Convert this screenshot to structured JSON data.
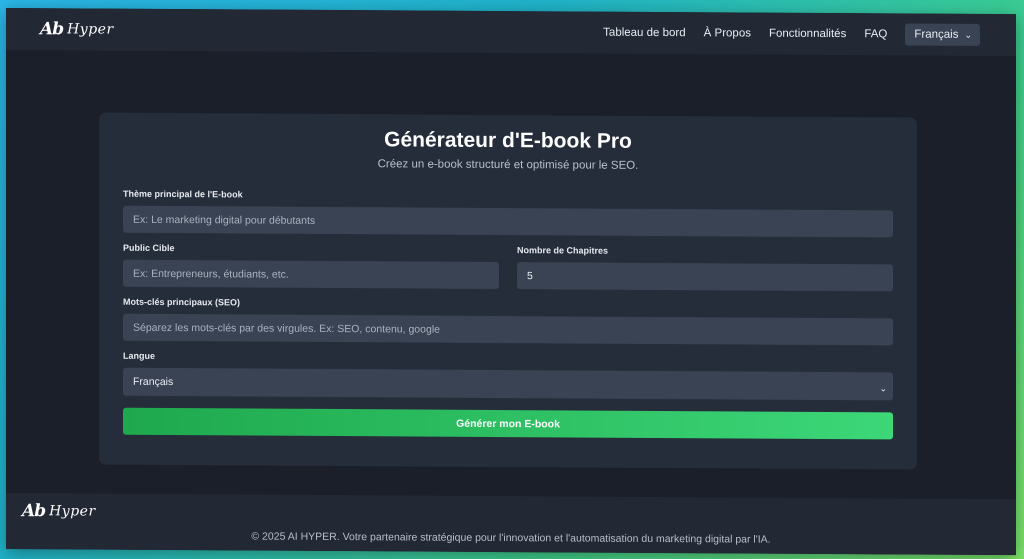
{
  "header": {
    "logo_mark": "Ab",
    "logo_text": "Hyper",
    "nav": [
      "Tableau de bord",
      "À Propos",
      "Fonctionnalités",
      "FAQ"
    ],
    "language": "Français"
  },
  "form": {
    "title": "Générateur d'E-book Pro",
    "subtitle": "Créez un e-book structuré et optimisé pour le SEO.",
    "theme_label": "Thème principal de l'E-book",
    "theme_placeholder": "Ex: Le marketing digital pour débutants",
    "audience_label": "Public Cible",
    "audience_placeholder": "Ex: Entrepreneurs, étudiants, etc.",
    "chapters_label": "Nombre de Chapitres",
    "chapters_value": "5",
    "keywords_label": "Mots-clés principaux (SEO)",
    "keywords_placeholder": "Séparez les mots-clés par des virgules. Ex: SEO, contenu, google",
    "language_label": "Langue",
    "language_value": "Français",
    "submit_label": "Générer mon E-book"
  },
  "footer": {
    "logo_mark": "Ab",
    "logo_text": "Hyper",
    "copyright": "© 2025 AI HYPER. Votre partenaire stratégique pour l'innovation et l'automatisation du marketing digital par l'IA."
  }
}
